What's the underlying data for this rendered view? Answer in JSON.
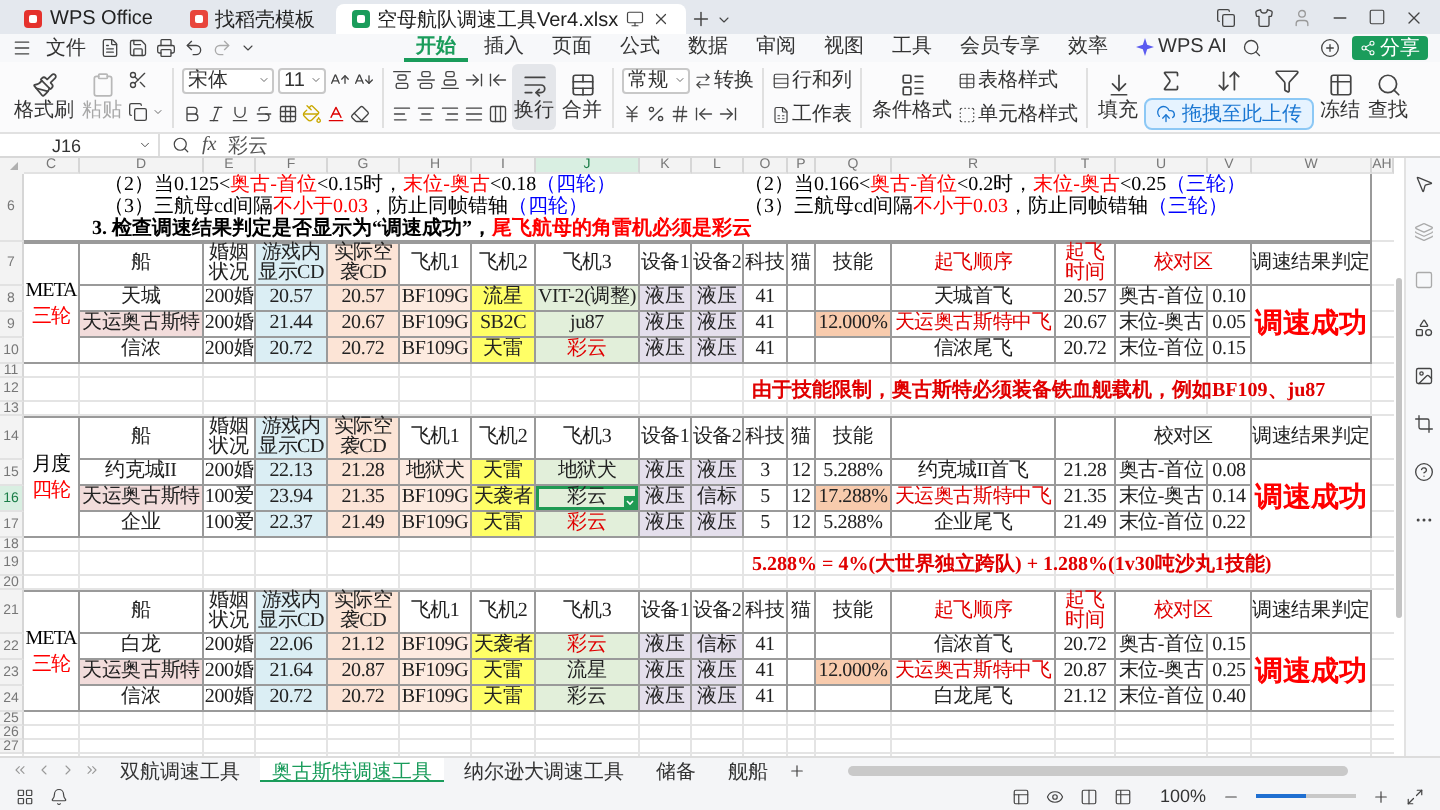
{
  "title_bar": {
    "tabs": [
      {
        "label": "WPS Office",
        "kind": "home",
        "selected": false
      },
      {
        "label": "找稻壳模板",
        "kind": "template",
        "selected": false
      },
      {
        "label": "空母航队调速工具Ver4.xlsx",
        "kind": "sheet",
        "selected": true
      }
    ]
  },
  "menu_bar": {
    "file": "文件",
    "tabs": [
      {
        "label": "开始",
        "kind": "tab",
        "selected": true
      },
      {
        "label": "插入",
        "kind": "tab",
        "selected": false
      },
      {
        "label": "页面",
        "kind": "tab",
        "selected": false
      },
      {
        "label": "公式",
        "kind": "tab",
        "selected": false
      },
      {
        "label": "数据",
        "kind": "tab",
        "selected": false
      },
      {
        "label": "审阅",
        "kind": "tab",
        "selected": false
      },
      {
        "label": "视图",
        "kind": "tab",
        "selected": false
      },
      {
        "label": "工具",
        "kind": "tab",
        "selected": false
      },
      {
        "label": "会员专享",
        "kind": "tab",
        "selected": false
      },
      {
        "label": "效率",
        "kind": "tab",
        "selected": false
      },
      {
        "label": "WPS AI",
        "kind": "ai",
        "selected": false
      }
    ],
    "share": "分享"
  },
  "ribbon": {
    "format_painter": "格式刷",
    "paste": {
      "label": "粘贴",
      "disabled": true
    },
    "font": "宋体",
    "font_size": "11",
    "wrap": "换行",
    "merge": "合并",
    "number_format": "常规",
    "convert": "转换",
    "rows_cols": "行和列",
    "sheet": "工作表",
    "conditional": "条件格式",
    "table_style": "表格样式",
    "cell_style": "单元格样式",
    "fill": "填充",
    "freeze": "冻结",
    "find": "查找",
    "upload": "拖拽至此上传"
  },
  "formula_bar": {
    "cell": "J16",
    "function_label": "fx",
    "value": "彩云"
  },
  "sheet": {
    "columns": [
      "C",
      "D",
      "E",
      "F",
      "G",
      "H",
      "I",
      "J",
      "K",
      "L",
      "O",
      "P",
      "Q",
      "R",
      "T",
      "U",
      "V",
      "W",
      "AH"
    ],
    "sections": [
      {
        "kind": "notes",
        "number": "6",
        "left": [
          [
            {
              "text": "（2）当0.125<",
              "color": "#000000"
            },
            {
              "text": "奥古-首位",
              "color": "#ff0000"
            },
            {
              "text": "<0.15时，",
              "color": "#000000"
            },
            {
              "text": "末位-奥古",
              "color": "#ff0000"
            },
            {
              "text": "<0.18",
              "color": "#000000"
            },
            {
              "text": "（四轮）",
              "color": "#0000ff"
            }
          ],
          [
            {
              "text": "（3）三航母cd间隔",
              "color": "#000000"
            },
            {
              "text": "不小于0.03",
              "color": "#ff0000"
            },
            {
              "text": "，防止同帧错轴",
              "color": "#000000"
            },
            {
              "text": "（四轮）",
              "color": "#0000ff"
            }
          ]
        ],
        "right": [
          [
            {
              "text": "（2）当0.166<",
              "color": "#000000"
            },
            {
              "text": "奥古-首位",
              "color": "#ff0000"
            },
            {
              "text": "<0.2时，",
              "color": "#000000"
            },
            {
              "text": "末位-奥古",
              "color": "#ff0000"
            },
            {
              "text": "<0.25",
              "color": "#000000"
            },
            {
              "text": "（三轮）",
              "color": "#0000ff"
            }
          ],
          [
            {
              "text": "（3）三航母cd间隔",
              "color": "#000000"
            },
            {
              "text": "不小于0.03",
              "color": "#ff0000"
            },
            {
              "text": "，防止同帧错轴",
              "color": "#000000"
            },
            {
              "text": "（三轮）",
              "color": "#0000ff"
            }
          ]
        ],
        "footer": {
          "bold": true,
          "parts": [
            {
              "text": "3. 检查调速结果判定是否显示为“调速成功”，",
              "color": "#000000"
            },
            {
              "text": "尾飞航母的角雷机必须是彩云",
              "color": "#ff0000"
            }
          ]
        }
      },
      {
        "kind": "table",
        "numbers": [
          "7",
          "8",
          "9",
          "10"
        ],
        "group": [
          {
            "text": "META",
            "color": "#000000"
          },
          {
            "text": "三轮",
            "color": "#ff0000"
          }
        ],
        "headers": [
          {
            "kind": "label",
            "text": "船",
            "alert": false
          },
          {
            "kind": "label",
            "text": "婚姻状况",
            "alert": false
          },
          {
            "kind": "label",
            "text": "游戏内显示CD",
            "alert": false
          },
          {
            "kind": "label",
            "text": "实际空袭CD",
            "alert": false
          },
          {
            "kind": "label",
            "text": "飞机1",
            "alert": false
          },
          {
            "kind": "label",
            "text": "飞机2",
            "alert": false
          },
          {
            "kind": "label",
            "text": "飞机3",
            "alert": false
          },
          {
            "kind": "label",
            "text": "设备1",
            "alert": false
          },
          {
            "kind": "label",
            "text": "设备2",
            "alert": false
          },
          {
            "kind": "label",
            "text": "科技",
            "alert": false
          },
          {
            "kind": "label",
            "text": "猫",
            "alert": false
          },
          {
            "kind": "label",
            "text": "技能",
            "alert": false
          },
          {
            "kind": "label",
            "text": "起飞顺序",
            "alert": true
          },
          {
            "kind": "label",
            "text": "起飞时间",
            "alert": true
          },
          {
            "kind": "label",
            "text": "校对区",
            "alert": true
          },
          {
            "kind": "label",
            "text": "调速结果判定",
            "alert": false
          }
        ],
        "rows": [
          {
            "cells": [
              "天城",
              "200婚",
              "20.57",
              "20.57",
              "BF109G",
              "流星",
              "VIT-2(调整)",
              "液压",
              "液压",
              "41",
              null,
              null,
              "天城首飞",
              "20.57",
              "奥古-首位",
              "0.10"
            ]
          },
          {
            "cells": [
              {
                "text": "天运奥古斯特",
                "highlight": true
              },
              "200婚",
              "21.44",
              "20.67",
              "BF109G",
              "SB2C",
              "ju87",
              "液压",
              "液压",
              "41",
              null,
              {
                "text": "12.000%",
                "highlight": true
              },
              {
                "text": "天运奥古斯特中飞",
                "red": true
              },
              "20.67",
              "末位-奥古",
              "0.05"
            ]
          },
          {
            "cells": [
              "信浓",
              "200婚",
              "20.72",
              "20.72",
              "BF109G",
              "天雷",
              {
                "text": "彩云",
                "red": true
              },
              "液压",
              "液压",
              "41",
              null,
              null,
              "信浓尾飞",
              "20.72",
              "末位-首位",
              "0.15"
            ]
          }
        ],
        "verdict": "调速成功"
      },
      {
        "kind": "blank",
        "number": "11"
      },
      {
        "kind": "note",
        "number": "12",
        "text": "由于技能限制，奥古斯特必须装备铁血舰载机，例如BF109、ju87"
      },
      {
        "kind": "blank",
        "number": "13"
      },
      {
        "kind": "table",
        "numbers": [
          "14",
          "15",
          "16",
          "17"
        ],
        "group": [
          {
            "text": "月度",
            "color": "#000000"
          },
          {
            "text": "四轮",
            "color": "#ff0000"
          }
        ],
        "headers": [
          {
            "kind": "label",
            "text": "船",
            "alert": false
          },
          {
            "kind": "label",
            "text": "婚姻状况",
            "alert": false
          },
          {
            "kind": "label",
            "text": "游戏内显示CD",
            "alert": false
          },
          {
            "kind": "label",
            "text": "实际空袭CD",
            "alert": false
          },
          {
            "kind": "label",
            "text": "飞机1",
            "alert": false
          },
          {
            "kind": "label",
            "text": "飞机2",
            "alert": false
          },
          {
            "kind": "label",
            "text": "飞机3",
            "alert": false
          },
          {
            "kind": "label",
            "text": "设备1",
            "alert": false
          },
          {
            "kind": "label",
            "text": "设备2",
            "alert": false
          },
          {
            "kind": "label",
            "text": "科技",
            "alert": false
          },
          {
            "kind": "label",
            "text": "猫",
            "alert": false
          },
          {
            "kind": "label",
            "text": "技能",
            "alert": false
          },
          {
            "kind": "empty"
          },
          {
            "kind": "empty"
          },
          {
            "kind": "label",
            "text": "校对区",
            "alert": false
          },
          {
            "kind": "label",
            "text": "调速结果判定",
            "alert": false
          }
        ],
        "rows": [
          {
            "cells": [
              "约克城II",
              "200婚",
              "22.13",
              "21.28",
              "地狱犬",
              "天雷",
              "地狱犬",
              "液压",
              "液压",
              "3",
              "12",
              "5.288%",
              "约克城II首飞",
              "21.28",
              "奥古-首位",
              "0.08"
            ]
          },
          {
            "cells": [
              {
                "text": "天运奥古斯特",
                "highlight": true
              },
              "100爱",
              "23.94",
              "21.35",
              "BF109G",
              "天袭者",
              {
                "text": "彩云",
                "selected": true
              },
              "液压",
              "信标",
              "5",
              "12",
              {
                "text": "17.288%",
                "highlight": true
              },
              {
                "text": "天运奥古斯特中飞",
                "red": true
              },
              "21.35",
              "末位-奥古",
              "0.14"
            ]
          },
          {
            "cells": [
              "企业",
              "100爱",
              "22.37",
              "21.49",
              "BF109G",
              "天雷",
              {
                "text": "彩云",
                "red": true
              },
              "液压",
              "液压",
              "5",
              "12",
              "5.288%",
              "企业尾飞",
              "21.49",
              "末位-首位",
              "0.22"
            ]
          }
        ],
        "verdict": "调速成功"
      },
      {
        "kind": "blank",
        "number": "18"
      },
      {
        "kind": "note",
        "number": "19",
        "text": "5.288% = 4%(大世界独立跨队) + 1.288%(1v30吨沙丸1技能)"
      },
      {
        "kind": "blank",
        "number": "20"
      },
      {
        "kind": "table",
        "numbers": [
          "21",
          "22",
          "23",
          "24"
        ],
        "group": [
          {
            "text": "META",
            "color": "#000000"
          },
          {
            "text": "三轮",
            "color": "#ff0000"
          }
        ],
        "headers": [
          {
            "kind": "label",
            "text": "船",
            "alert": false
          },
          {
            "kind": "label",
            "text": "婚姻状况",
            "alert": false
          },
          {
            "kind": "label",
            "text": "游戏内显示CD",
            "alert": false
          },
          {
            "kind": "label",
            "text": "实际空袭CD",
            "alert": false
          },
          {
            "kind": "label",
            "text": "飞机1",
            "alert": false
          },
          {
            "kind": "label",
            "text": "飞机2",
            "alert": false
          },
          {
            "kind": "label",
            "text": "飞机3",
            "alert": false
          },
          {
            "kind": "label",
            "text": "设备1",
            "alert": false
          },
          {
            "kind": "label",
            "text": "设备2",
            "alert": false
          },
          {
            "kind": "label",
            "text": "科技",
            "alert": false
          },
          {
            "kind": "label",
            "text": "猫",
            "alert": false
          },
          {
            "kind": "label",
            "text": "技能",
            "alert": false
          },
          {
            "kind": "label",
            "text": "起飞顺序",
            "alert": true
          },
          {
            "kind": "label",
            "text": "起飞时间",
            "alert": true
          },
          {
            "kind": "label",
            "text": "校对区",
            "alert": true
          },
          {
            "kind": "label",
            "text": "调速结果判定",
            "alert": false
          }
        ],
        "rows": [
          {
            "cells": [
              "白龙",
              "200婚",
              "22.06",
              "21.12",
              "BF109G",
              "天袭者",
              {
                "text": "彩云",
                "red": true
              },
              "液压",
              "信标",
              "41",
              null,
              null,
              "信浓首飞",
              "20.72",
              "奥古-首位",
              "0.15"
            ]
          },
          {
            "cells": [
              {
                "text": "天运奥古斯特",
                "highlight": true
              },
              "200婚",
              "21.64",
              "20.87",
              "BF109G",
              "天雷",
              "流星",
              "液压",
              "液压",
              "41",
              null,
              {
                "text": "12.000%",
                "highlight": true
              },
              {
                "text": "天运奥古斯特中飞",
                "red": true
              },
              "20.87",
              "末位-奥古",
              "0.25"
            ]
          },
          {
            "cells": [
              "信浓",
              "200婚",
              "20.72",
              "20.72",
              "BF109G",
              "天雷",
              "彩云",
              "液压",
              "液压",
              "41",
              null,
              null,
              "白龙尾飞",
              "21.12",
              "末位-首位",
              "0.40"
            ]
          }
        ],
        "verdict": "调速成功"
      },
      {
        "kind": "blank",
        "number": "25"
      },
      {
        "kind": "blank",
        "number": "26"
      },
      {
        "kind": "blank",
        "number": "27"
      }
    ]
  },
  "sheet_tabs": {
    "tabs": [
      {
        "label": "双航调速工具",
        "selected": false
      },
      {
        "label": "奥古斯特调速工具",
        "selected": true
      },
      {
        "label": "纳尔逊大调速工具",
        "selected": false
      },
      {
        "label": "储备",
        "selected": false
      },
      {
        "label": "舰船",
        "selected": false
      }
    ]
  },
  "status_bar": {
    "zoom_text": "100%",
    "zoom_slider": {
      "level": 0.5
    }
  }
}
